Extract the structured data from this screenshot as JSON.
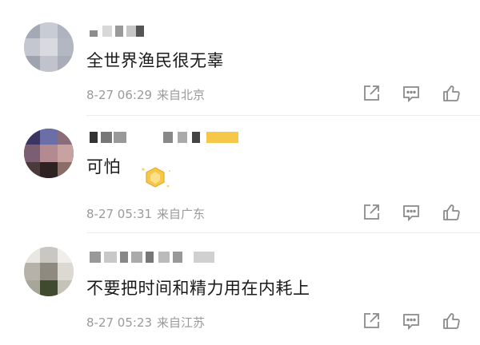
{
  "comments": [
    {
      "text": "全世界渔民很无辜",
      "time": "8-27 06:29",
      "location": "来自北京"
    },
    {
      "text": "可怕",
      "time": "8-27 05:31",
      "location": "来自广东"
    },
    {
      "text": "不要把时间和精力用在内耗上",
      "time": "8-27 05:23",
      "location": "来自江苏"
    }
  ],
  "icons": {
    "share": "share-icon",
    "reply": "comment-icon",
    "like": "thumbs-up-icon"
  },
  "colors": {
    "text": "#1a1a1a",
    "meta": "#9a9a9a",
    "icon": "#8a8a8a",
    "badge": "#f6c84a"
  }
}
